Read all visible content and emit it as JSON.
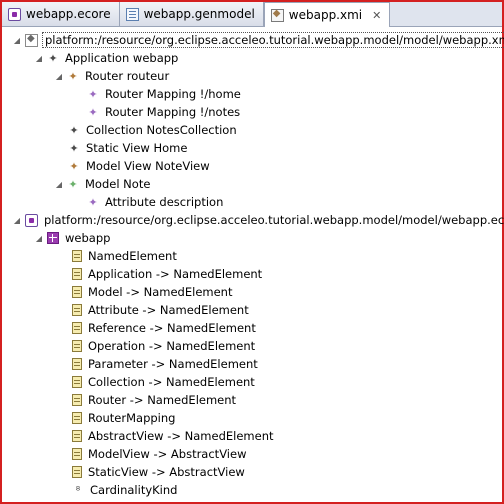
{
  "tabs": [
    {
      "label": "webapp.ecore",
      "icon": "ecore-file-icon",
      "active": false
    },
    {
      "label": "webapp.genmodel",
      "icon": "genmodel-file-icon",
      "active": false
    },
    {
      "label": "webapp.xmi",
      "icon": "xmi-file-icon",
      "active": true,
      "close": "✕"
    }
  ],
  "tree": {
    "xmi_resource": {
      "label": "platform:/resource/org.eclipse.acceleo.tutorial.webapp.model/model/webapp.xmi",
      "application": {
        "label": "Application webapp",
        "router": {
          "label": "Router routeur",
          "children": [
            "Router Mapping !/home",
            "Router Mapping !/notes"
          ]
        },
        "collection": "Collection NotesCollection",
        "static_view": "Static View Home",
        "model_view": "Model View NoteView",
        "model": {
          "label": "Model Note",
          "children": [
            "Attribute description"
          ]
        }
      }
    },
    "ecore_resource": {
      "label": "platform:/resource/org.eclipse.acceleo.tutorial.webapp.model/model/webapp.ecore",
      "package": {
        "label": "webapp",
        "classes": [
          "NamedElement",
          "Application -> NamedElement",
          "Model -> NamedElement",
          "Attribute -> NamedElement",
          "Reference -> NamedElement",
          "Operation -> NamedElement",
          "Parameter -> NamedElement",
          "Collection -> NamedElement",
          "Router -> NamedElement",
          "RouterMapping",
          "AbstractView -> NamedElement",
          "ModelView -> AbstractView",
          "StaticView -> AbstractView"
        ],
        "enum": "CardinalityKind"
      }
    }
  },
  "colors": {
    "frame_border": "#d42020",
    "application_icon": "#4a4a4a",
    "router_icon": "#b07a3a",
    "mapping_icon": "#9a6ac0",
    "collection_icon": "#4a4a4a",
    "static_view_icon": "#4a4a4a",
    "model_view_icon": "#b07a3a",
    "model_icon": "#6ab06a",
    "attribute_icon": "#9a6ac0"
  }
}
